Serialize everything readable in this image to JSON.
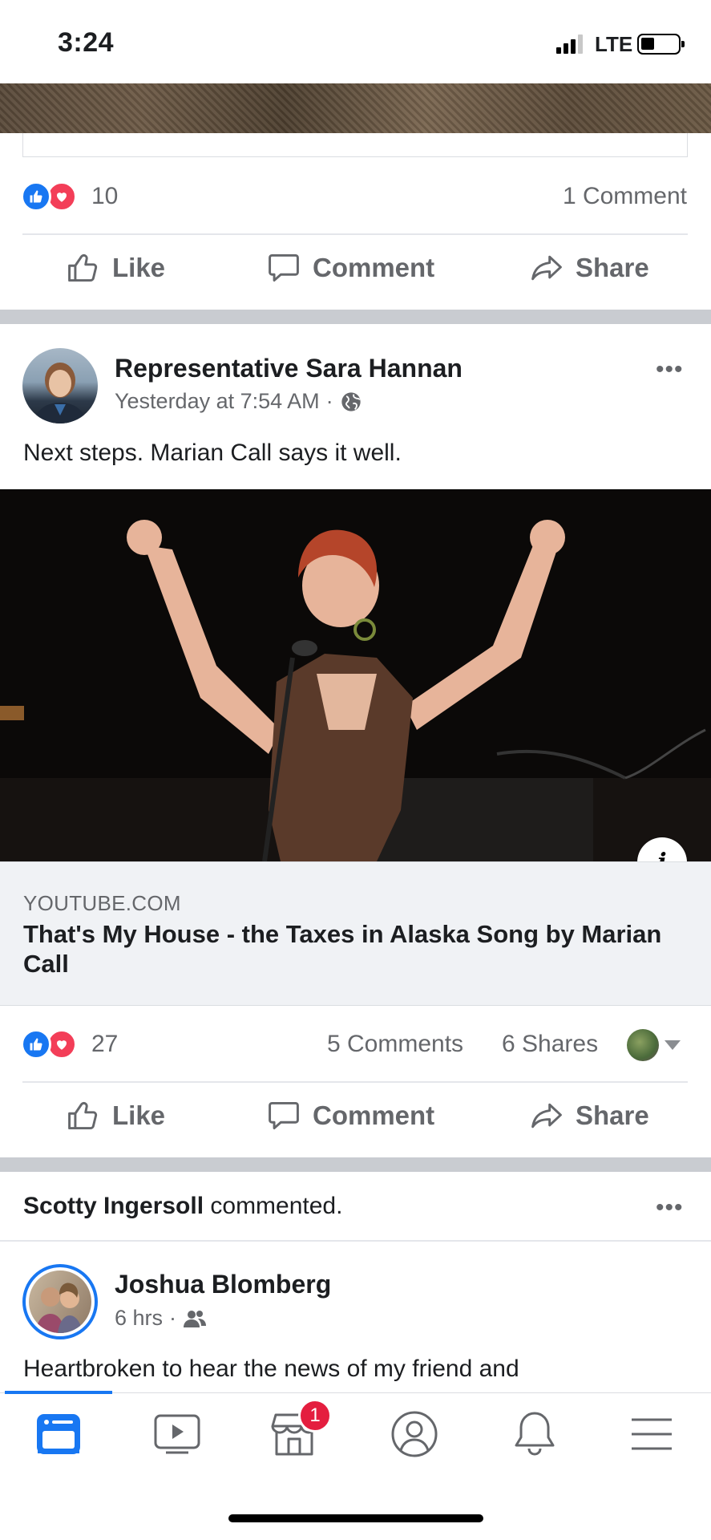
{
  "status_bar": {
    "time": "3:24",
    "network": "LTE"
  },
  "post_prev": {
    "reaction_count": "10",
    "comments": "1 Comment"
  },
  "actions": {
    "like": "Like",
    "comment": "Comment",
    "share": "Share"
  },
  "post_main": {
    "author": "Representative Sara Hannan",
    "timestamp": "Yesterday at 7:54 AM",
    "text": "Next steps. Marian Call says it well.",
    "link_domain": "YOUTUBE.COM",
    "link_title": "That's My House - the Taxes in Alaska Song by Marian Call",
    "info": "i",
    "reaction_count": "27",
    "comments": "5 Comments",
    "shares": "6 Shares"
  },
  "activity": {
    "actor": "Scotty Ingersoll",
    "action": " commented."
  },
  "post_next": {
    "author": "Joshua Blomberg",
    "timestamp": "6 hrs",
    "text": "Heartbroken to hear the news of my friend and"
  },
  "tabbar": {
    "marketplace_badge": "1"
  },
  "colors": {
    "brand_blue": "#1877f2",
    "love_red": "#f33e58",
    "badge_red": "#e41e3f"
  }
}
